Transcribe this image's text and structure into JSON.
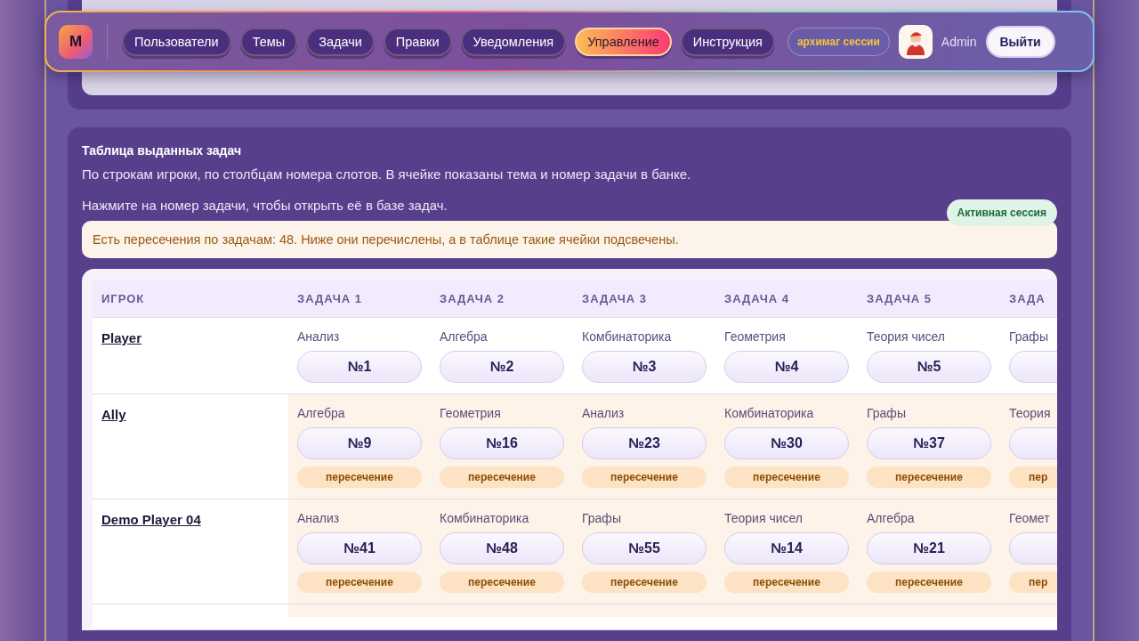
{
  "nav": {
    "logo": "M",
    "items": [
      {
        "label": "Пользователи",
        "selected": false
      },
      {
        "label": "Темы",
        "selected": false
      },
      {
        "label": "Задачи",
        "selected": false
      },
      {
        "label": "Правки",
        "selected": false
      },
      {
        "label": "Уведомления",
        "selected": false
      },
      {
        "label": "Управление",
        "selected": true
      },
      {
        "label": "Инструкция",
        "selected": false
      }
    ],
    "role_badge": "архимаг сессии",
    "user": "Admin",
    "logout": "Выйти"
  },
  "section": {
    "title": "Таблица выданных задач",
    "description": "По строкам игроки, по столбцам номера слотов. В ячейке показаны тема и номер задачи в банке.",
    "hint": "Нажмите на номер задачи, чтобы открыть её в базе задач.",
    "status_badge": "Активная сессия",
    "alert": "Есть пересечения по задачам: 48. Ниже они перечислены, а в таблице такие ячейки подсвечены."
  },
  "table": {
    "columns": [
      "ИГРОК",
      "ЗАДАЧА 1",
      "ЗАДАЧА 2",
      "ЗАДАЧА 3",
      "ЗАДАЧА 4",
      "ЗАДАЧА 5",
      "ЗАДА"
    ],
    "rows": [
      {
        "overlap": false,
        "cells": [
          {
            "kind": "player",
            "text": "Player"
          },
          {
            "kind": "task",
            "topic": "Анализ",
            "number": "№1"
          },
          {
            "kind": "task",
            "topic": "Алгебра",
            "number": "№2"
          },
          {
            "kind": "task",
            "topic": "Комбинаторика",
            "number": "№3"
          },
          {
            "kind": "task",
            "topic": "Геометрия",
            "number": "№4"
          },
          {
            "kind": "task",
            "topic": "Теория чисел",
            "number": "№5"
          },
          {
            "kind": "task",
            "topic": "Графы"
          }
        ]
      },
      {
        "overlap": true,
        "cells": [
          {
            "kind": "player",
            "text": "Ally"
          },
          {
            "kind": "task",
            "topic": "Алгебра",
            "number": "№9",
            "badge": "пересечение"
          },
          {
            "kind": "task",
            "topic": "Геометрия",
            "number": "№16",
            "badge": "пересечение"
          },
          {
            "kind": "task",
            "topic": "Анализ",
            "number": "№23",
            "badge": "пересечение"
          },
          {
            "kind": "task",
            "topic": "Комбинаторика",
            "number": "№30",
            "badge": "пересечение"
          },
          {
            "kind": "task",
            "topic": "Графы",
            "number": "№37",
            "badge": "пересечение"
          },
          {
            "kind": "task",
            "topic": "Теория",
            "badge": "пер"
          }
        ]
      },
      {
        "overlap": true,
        "cells": [
          {
            "kind": "player",
            "text": "Demo Player 04"
          },
          {
            "kind": "task",
            "topic": "Анализ",
            "number": "№41",
            "badge": "пересечение"
          },
          {
            "kind": "task",
            "topic": "Комбинаторика",
            "number": "№48",
            "badge": "пересечение"
          },
          {
            "kind": "task",
            "topic": "Графы",
            "number": "№55",
            "badge": "пересечение"
          },
          {
            "kind": "task",
            "topic": "Теория чисел",
            "number": "№14",
            "badge": "пересечение"
          },
          {
            "kind": "task",
            "topic": "Алгебра",
            "number": "№21",
            "badge": "пересечение"
          },
          {
            "kind": "task",
            "topic": "Геомет",
            "badge": "пер"
          }
        ]
      }
    ]
  }
}
